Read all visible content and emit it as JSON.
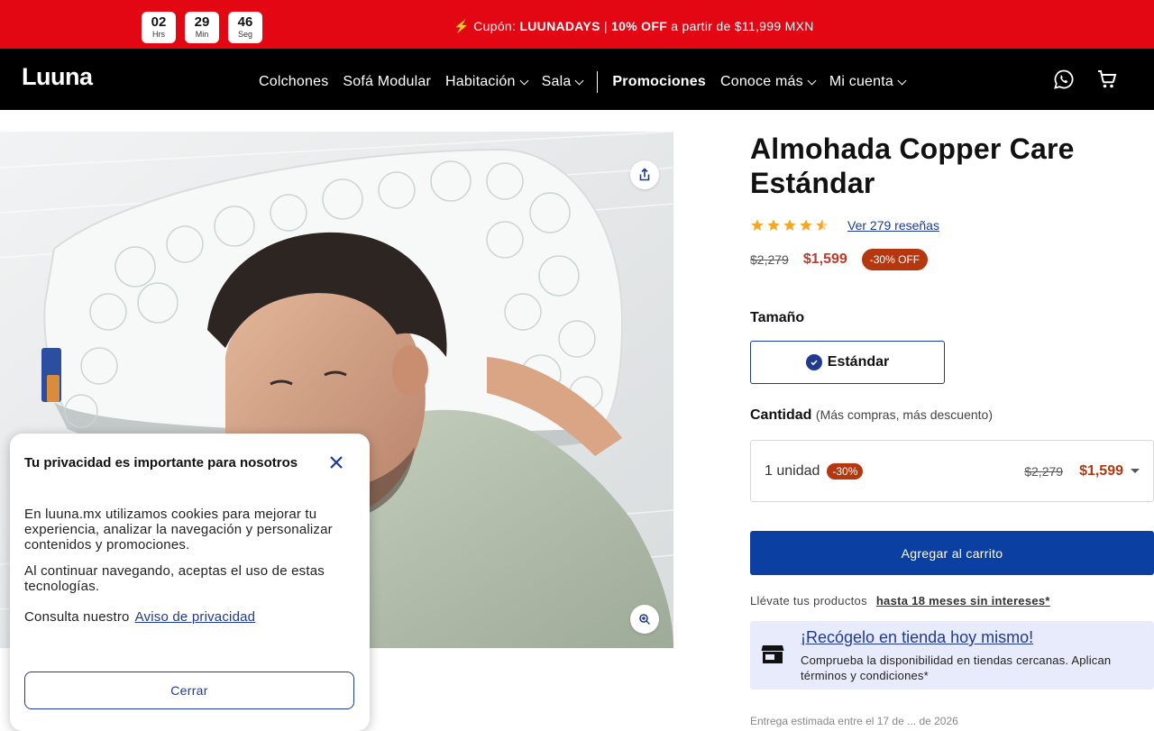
{
  "promo_bar": {
    "countdown": [
      {
        "value": "02",
        "unit": "Hrs"
      },
      {
        "value": "29",
        "unit": "Min"
      },
      {
        "value": "46",
        "unit": "Seg"
      }
    ],
    "prefix": "⚡ Cupón: ",
    "code": "LUUNADAYS",
    "separator": " | ",
    "discount": "10% OFF",
    "suffix": " a partir de $11,999 MXN"
  },
  "header": {
    "logo": "Luuna",
    "nav": [
      "Colchones",
      "Sofá Modular",
      "Habitación",
      "Sala",
      "Promociones",
      "Conoce más",
      "Mi cuenta"
    ],
    "icons": [
      "whatsapp-icon",
      "cart-icon"
    ]
  },
  "product": {
    "title": "Almohada Copper Care Estándar",
    "rating": 4.5,
    "reviews_link": "Ver 279 reseñas",
    "old_price": "$2,279",
    "price": "$1,599",
    "off_badge": "-30% OFF",
    "size_label": "Tamaño",
    "size_option": "Estándar",
    "qty_label": "Cantidad",
    "qty_note": "(Más compras, más descuento)",
    "qty_select": {
      "label": "1 unidad",
      "badge": "-30%",
      "old_price": "$2,279",
      "price": "$1,599"
    },
    "add_to_cart": "Agregar al carrito",
    "msi_text": "Llévate tus productos",
    "msi_link": "hasta 18 meses sin intereses*",
    "store": {
      "title": "¡Recógelo en tienda hoy mismo!",
      "text": "Comprueba la disponibilidad en tiendas cercanas. Aplican términos y condiciones*"
    },
    "cut_text": "Entrega estimada entre el 17 de ... de 2026"
  },
  "cookie": {
    "title": "Tu privacidad es importante para nosotros",
    "p1": "En luuna.mx utilizamos cookies para mejorar tu experiencia, analizar la navegación y personalizar contenidos y promociones.",
    "p2": "Al continuar navegando, aceptas el uso de estas tecnologías.",
    "p3": "Consulta nuestro",
    "p3_link": "Aviso de privacidad",
    "button": "Cerrar"
  },
  "colors": {
    "promo_red": "#e30613",
    "header_black": "#000000",
    "brand_blue": "#0b3fa1",
    "discount_orange": "#b5370f",
    "store_bg": "#e8ebfb"
  }
}
